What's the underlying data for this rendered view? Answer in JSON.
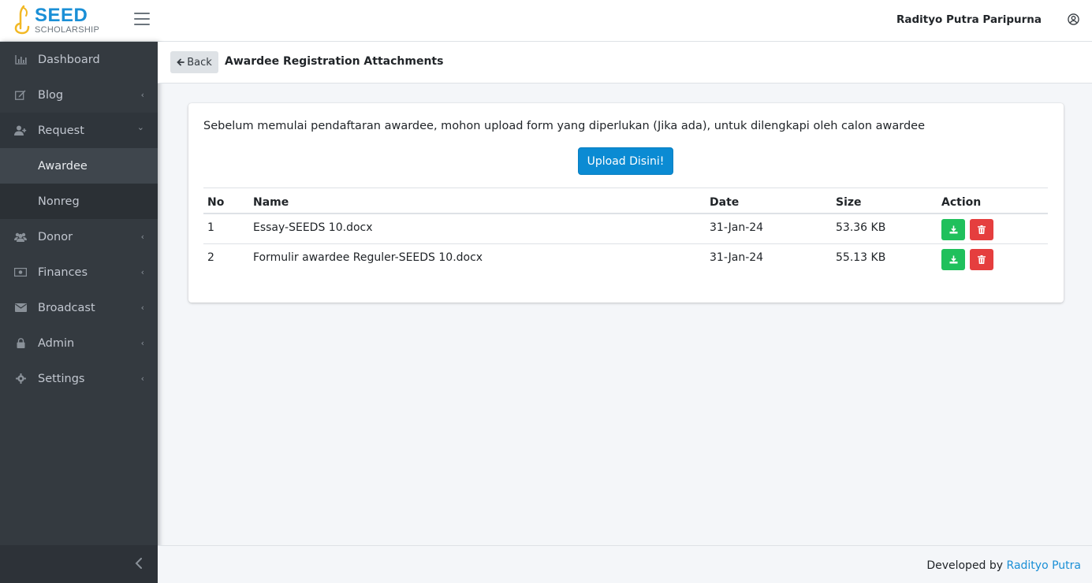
{
  "brand": {
    "name": "SEED",
    "subtitle": "SCHOLARSHIP"
  },
  "header": {
    "user_name": "Radityo Putra Paripurna"
  },
  "sidebar": {
    "items": [
      {
        "label": "Dashboard",
        "icon": "bar-chart-icon"
      },
      {
        "label": "Blog",
        "icon": "edit-icon",
        "chevron": "‹"
      },
      {
        "label": "Request",
        "icon": "user-plus-icon",
        "chevron": "⌄"
      },
      {
        "label": "Awardee",
        "sub": true,
        "active": true
      },
      {
        "label": "Nonreg",
        "sub": true
      },
      {
        "label": "Donor",
        "icon": "users-icon",
        "chevron": "‹"
      },
      {
        "label": "Finances",
        "icon": "money-icon",
        "chevron": "‹"
      },
      {
        "label": "Broadcast",
        "icon": "envelope-icon",
        "chevron": "‹"
      },
      {
        "label": "Admin",
        "icon": "lock-icon",
        "chevron": "‹"
      },
      {
        "label": "Settings",
        "icon": "gear-icon",
        "chevron": "‹"
      }
    ]
  },
  "content": {
    "back_label": "Back",
    "title": "Awardee Registration Attachments",
    "instruction": "Sebelum memulai pendaftaran awardee, mohon upload form yang diperlukan (Jika ada), untuk dilengkapi oleh calon awardee",
    "upload_label": "Upload Disini!",
    "table": {
      "headers": [
        "No",
        "Name",
        "Date",
        "Size",
        "Action"
      ],
      "rows": [
        {
          "no": "1",
          "name": "Essay-SEEDS 10.docx",
          "date": "31-Jan-24",
          "size": "53.36 KB"
        },
        {
          "no": "2",
          "name": "Formulir awardee Reguler-SEEDS 10.docx",
          "date": "31-Jan-24",
          "size": "55.13 KB"
        }
      ]
    }
  },
  "footer": {
    "prefix": "Developed by ",
    "link": "Radityo Putra"
  },
  "colors": {
    "accent": "#0b8bd3",
    "success": "#20c05c",
    "danger": "#e53e3e",
    "sidebar": "#343a40"
  }
}
